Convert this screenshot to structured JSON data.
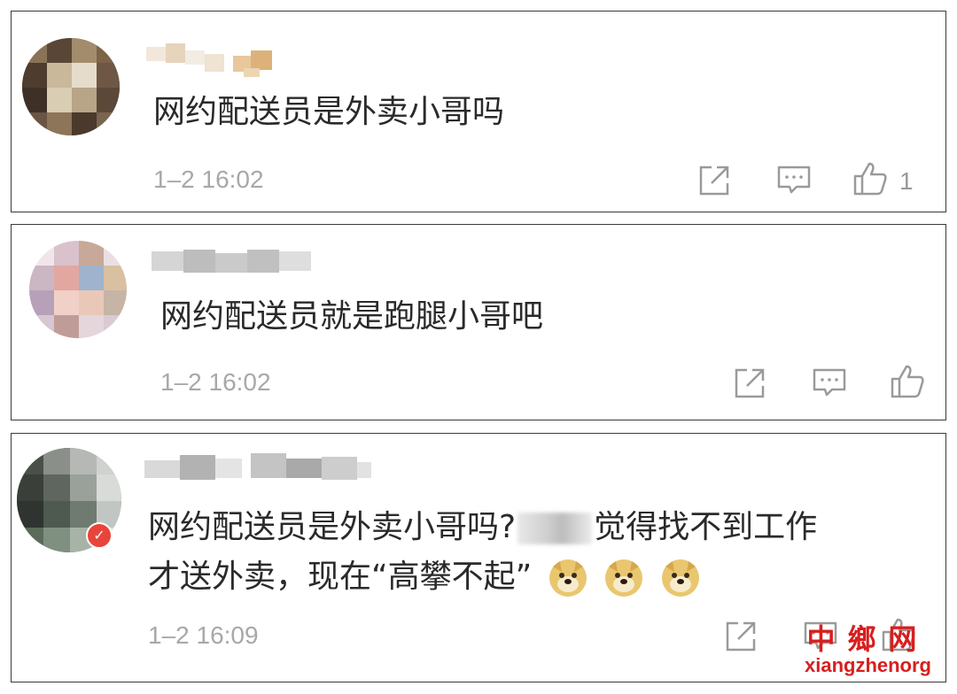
{
  "comments": [
    {
      "text": "网约配送员是外卖小哥吗",
      "time": "1–2 16:02",
      "likes": "1"
    },
    {
      "text": "网约配送员就是跑腿小哥吧",
      "time": "1–2 16:02",
      "likes": ""
    },
    {
      "text_line1_a": "网约配送员是外卖小哥吗?",
      "text_line1_b": "觉得找不到工作",
      "text_line2": "才送外卖，现在“高攀不起”",
      "time": "1–2 16:09",
      "likes": ""
    }
  ],
  "icons": {
    "share": "share-icon",
    "comment": "comment-icon",
    "like": "thumbs-up-icon",
    "emoji": "doge-emoji-icon",
    "verified": "verified-badge-icon"
  },
  "watermark": {
    "chinese": "中鄉网",
    "latin": "xiangzhenorg"
  },
  "colors": {
    "text": "#2a2a2a",
    "meta": "#a8a8a8",
    "watermark": "#d81e1e"
  }
}
